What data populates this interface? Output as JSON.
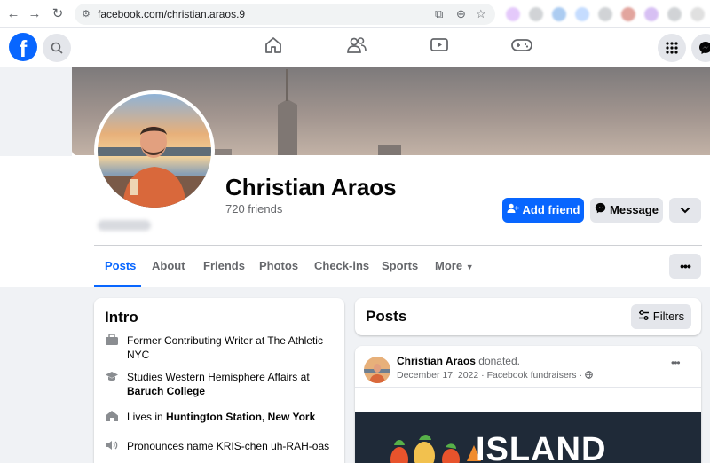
{
  "browser": {
    "url": "facebook.com/christian.araos.9"
  },
  "nav": {
    "icons": [
      "home-icon",
      "friends-icon",
      "video-icon",
      "gaming-icon"
    ]
  },
  "profile": {
    "name": "Christian Araos",
    "friends_count": "720 friends",
    "add_friend_label": "Add friend",
    "message_label": "Message"
  },
  "tabs": [
    {
      "label": "Posts",
      "active": true
    },
    {
      "label": "About"
    },
    {
      "label": "Friends"
    },
    {
      "label": "Photos"
    },
    {
      "label": "Check-ins"
    },
    {
      "label": "Sports"
    },
    {
      "label": "More"
    }
  ],
  "intro": {
    "title": "Intro",
    "work": "Former Contributing Writer at The Athletic NYC",
    "study_prefix": "Studies Western Hemisphere Affairs at",
    "study_school": "Baruch College",
    "lives_prefix": "Lives in",
    "lives_place": "Huntington Station, New York",
    "pronounce": "Pronounces name KRIS-chen uh-RAH-oas"
  },
  "posts": {
    "title": "Posts",
    "filters_label": "Filters",
    "post": {
      "author": "Christian Araos",
      "action": "donated.",
      "date": "December 17, 2022",
      "source": "Facebook fundraisers",
      "separator": "·",
      "banner_text": "ISLAND"
    }
  },
  "colors": {
    "brand": "#0866ff",
    "background": "#f0f2f5"
  }
}
